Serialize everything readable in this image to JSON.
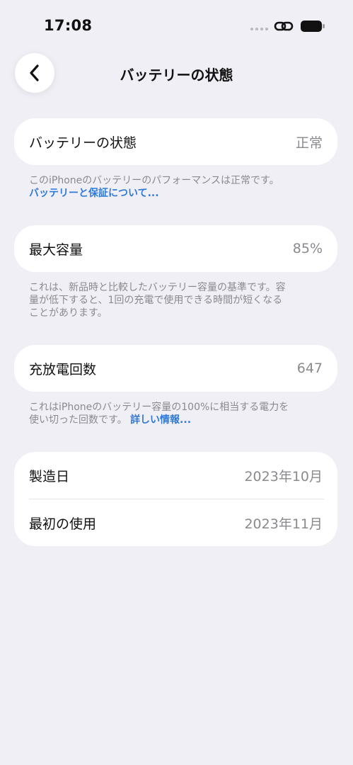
{
  "status_bar": {
    "time": "17:08",
    "icons": [
      "signal-dots-icon",
      "link-icon",
      "battery-icon"
    ]
  },
  "nav": {
    "title": "バッテリーの状態",
    "back_icon": "chevron-left-icon"
  },
  "health": {
    "label": "バッテリーの状態",
    "value": "正常",
    "footnote": "このiPhoneのバッテリーのパフォーマンスは正常です。",
    "link": "バッテリーと保証について..."
  },
  "max_capacity": {
    "label": "最大容量",
    "value": "85%",
    "footnote_line1": "これは、新品時と比較したバッテリー容量の基準です。容",
    "footnote_line2": "量が低下すると、1回の充電で使用できる時間が短くなる",
    "footnote_line3": "ことがあります。"
  },
  "cycle_count": {
    "label": "充放電回数",
    "value": "647",
    "footnote_line1": "これはiPhoneのバッテリー容量の100%に相当する電力を",
    "footnote_line2": "使い切った回数です。",
    "link": "詳しい情報..."
  },
  "dates": {
    "manufacture_label": "製造日",
    "manufacture_value": "2023年10月",
    "first_use_label": "最初の使用",
    "first_use_value": "2023年11月"
  },
  "colors": {
    "background": "#f0eff5",
    "card": "#ffffff",
    "link": "#2f7bd9",
    "secondary_text": "#8a8a8e"
  }
}
